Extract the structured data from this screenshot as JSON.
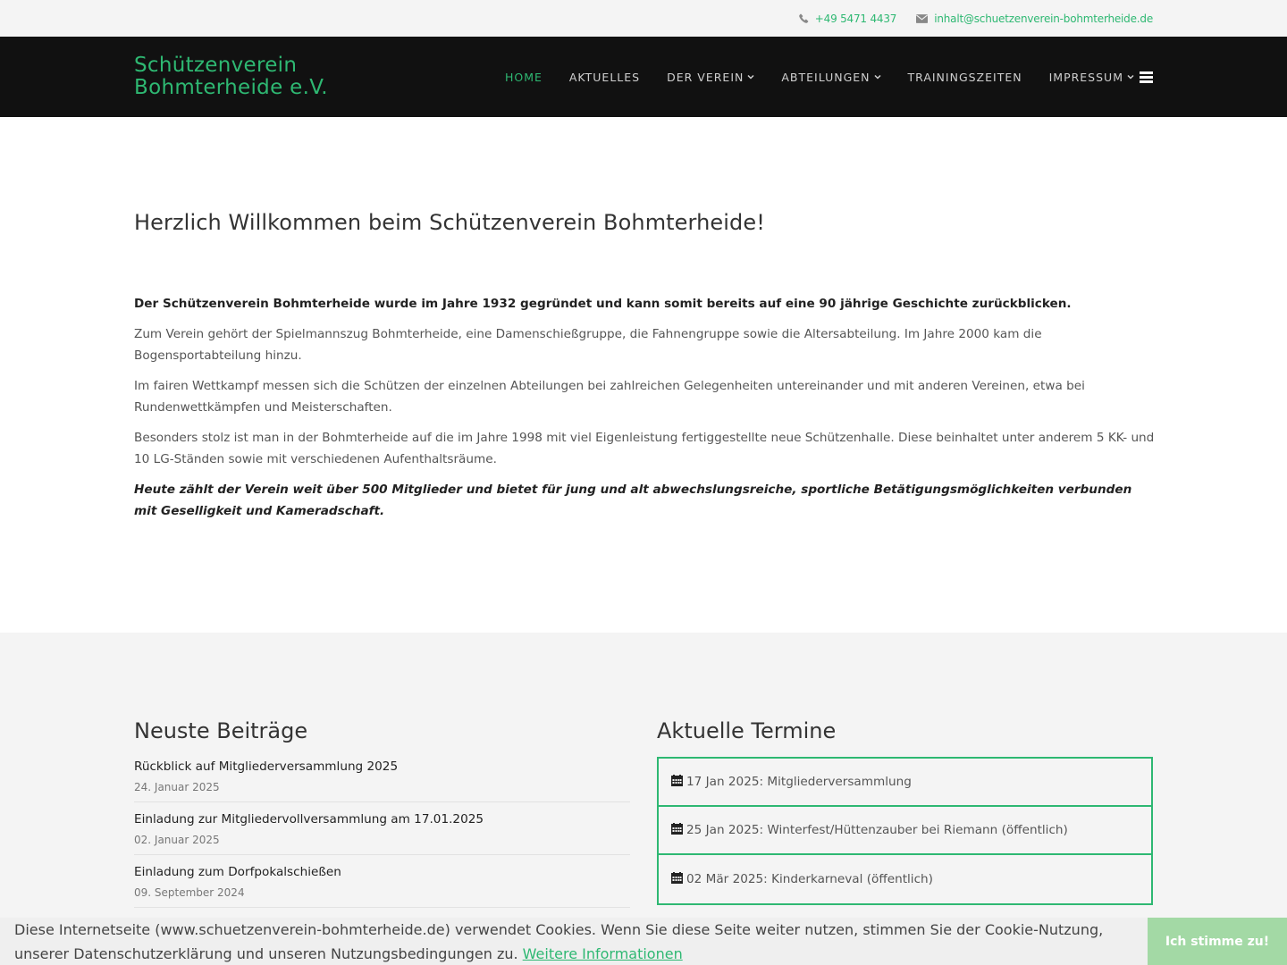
{
  "topbar": {
    "phone": "+49 5471 4437",
    "email": "inhalt@schuetzenverein-bohmterheide.de",
    "phone_icon": "phone-icon",
    "email_icon": "envelope-icon"
  },
  "nav": {
    "brand_line1": "Schützenverein",
    "brand_line2": "Bohmterheide e.V.",
    "items": [
      {
        "label": "Home"
      },
      {
        "label": "Aktuelles"
      },
      {
        "label": "Der Verein"
      },
      {
        "label": "Abteilungen"
      },
      {
        "label": "Trainingszeiten"
      },
      {
        "label": "Impressum"
      }
    ]
  },
  "main": {
    "heading": "Herzlich Willkommen beim Schützenverein Bohmterheide!",
    "paragraphs": [
      "Der Schützenverein Bohmterheide wurde im Jahre 1932 gegründet und kann somit bereits auf eine 90 jährige Geschichte zurückblicken.",
      "Zum Verein gehört der Spielmannszug Bohmterheide, eine Damenschießgruppe, die Fahnengruppe sowie die Altersabteilung. Im Jahre 2000 kam die Bogensportabteilung hinzu.",
      "Im fairen Wettkampf messen sich die Schützen der einzelnen Abteilungen bei zahlreichen Gelegenheiten untereinander und mit anderen Vereinen, etwa bei Rundenwettkämpfen und Meisterschaften.",
      "Besonders stolz ist man in der Bohmterheide auf die im Jahre 1998 mit viel Eigenleistung fertiggestellte neue Schützenhalle. Diese beinhaltet unter anderem  5 KK- und 10 LG-Ständen sowie mit verschiedenen Aufenthaltsräume.",
      "Heute zählt der Verein weit über 500 Mitglieder und bietet für jung und alt abwechslungsreiche, sportliche Betätigungsmöglichkeiten verbunden mit Geselligkeit und Kameradschaft."
    ]
  },
  "posts": {
    "title": "Neuste Beiträge",
    "items": [
      {
        "title": "Rückblick auf Mitgliederversammlung 2025",
        "date": "24. Januar 2025"
      },
      {
        "title": "Einladung zur Mitgliedervollversammlung am 17.01.2025",
        "date": "02. Januar 2025"
      },
      {
        "title": "Einladung zum Dorfpokalschießen",
        "date": "09. September 2024"
      }
    ]
  },
  "events": {
    "title": "Aktuelle Termine",
    "icon": "calendar-icon",
    "items": [
      {
        "label": "17 Jan 2025: Mitgliederversammlung"
      },
      {
        "label": "25 Jan 2025: Winterfest/Hüttenzauber bei Riemann (öffentlich)"
      },
      {
        "label": "02 Mär 2025: Kinderkarneval (öffentlich)"
      }
    ]
  },
  "cookie": {
    "message": "Diese Internetseite (www.schuetzenverein-bohmterheide.de) verwendet Cookies. Wenn Sie diese Seite weiter nutzen, stimmen Sie der Cookie-Nutzung, unserer Datenschutzerklärung und unseren Nutzungsbedingungen zu.",
    "link": "Weitere Informationen",
    "accept": "Ich stimme zu!"
  },
  "colors": {
    "accent": "#2eb872",
    "nav_bg": "#111111",
    "topbar_bg": "#f4f4f4",
    "cookie_button": "#a3d9a5"
  }
}
